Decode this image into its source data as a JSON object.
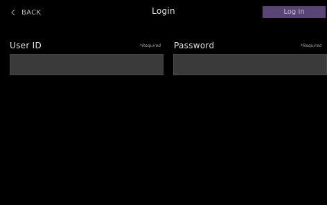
{
  "header": {
    "back_label": "BACK",
    "title": "Login",
    "login_button_label": "Log In"
  },
  "form": {
    "user_id": {
      "label": "User ID",
      "required_note": "*Required",
      "value": ""
    },
    "password": {
      "label": "Password",
      "required_note": "*Required",
      "value": ""
    }
  },
  "icons": {
    "back": "chevron-left-icon"
  },
  "colors": {
    "background": "#000000",
    "accent": "#5b4478",
    "field_background": "#3a3a3a",
    "text": "#e3e3e3"
  }
}
